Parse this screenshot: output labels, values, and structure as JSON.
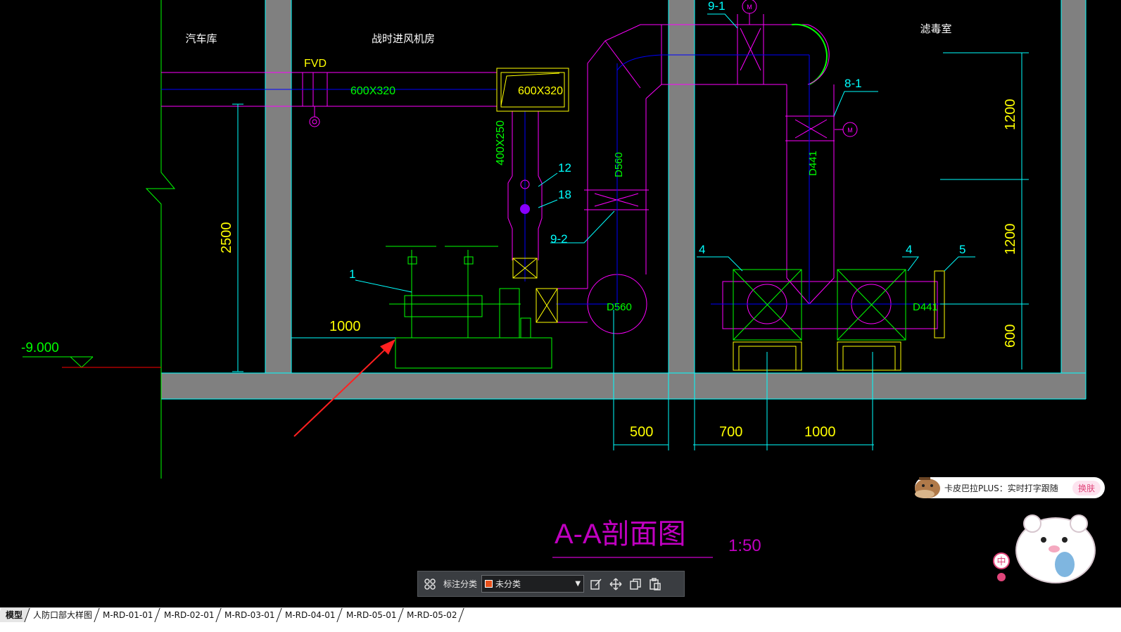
{
  "drawing": {
    "room_labels": [
      "汽车库",
      "战时进风机房",
      "滤毒室"
    ],
    "duct_labels": [
      "FVD",
      "600X320",
      "600X320",
      "400X250",
      "D560",
      "D441",
      "D560",
      "D441"
    ],
    "item_tags": [
      "9-1",
      "8-1",
      "12",
      "18",
      "9-2",
      "1",
      "4",
      "4",
      "5"
    ],
    "dimensions_vertical": [
      "2500",
      "1200",
      "1200",
      "600"
    ],
    "dimensions_horizontal": [
      "1000",
      "500",
      "700",
      "1000"
    ],
    "elevation": "-9.000",
    "motor_symbol": "M",
    "section_title": "A-A剖面图",
    "scale": "1:50",
    "colors": {
      "wall": "#808080",
      "magenta": "#ff00ff",
      "yellow": "#ffff00",
      "green": "#00ff00",
      "cyan": "#00ffff",
      "blue": "#0000ff",
      "red": "#ff0000",
      "purple_title": "#c000c0"
    }
  },
  "toolbar": {
    "label": "标注分类",
    "selected_value": "未分类",
    "swatch_color": "#e8501a",
    "icons": [
      "grid-icon",
      "edit-icon",
      "move-icon",
      "copy-icon",
      "paste-icon"
    ]
  },
  "ime": {
    "text": "卡皮巴拉PLUS：实时打字跟随",
    "skin_button": "换肤",
    "mode_char": "中"
  },
  "tabs": [
    "模型",
    "人防口部大样图",
    "M-RD-01-01",
    "M-RD-02-01",
    "M-RD-03-01",
    "M-RD-04-01",
    "M-RD-05-01",
    "M-RD-05-02"
  ]
}
